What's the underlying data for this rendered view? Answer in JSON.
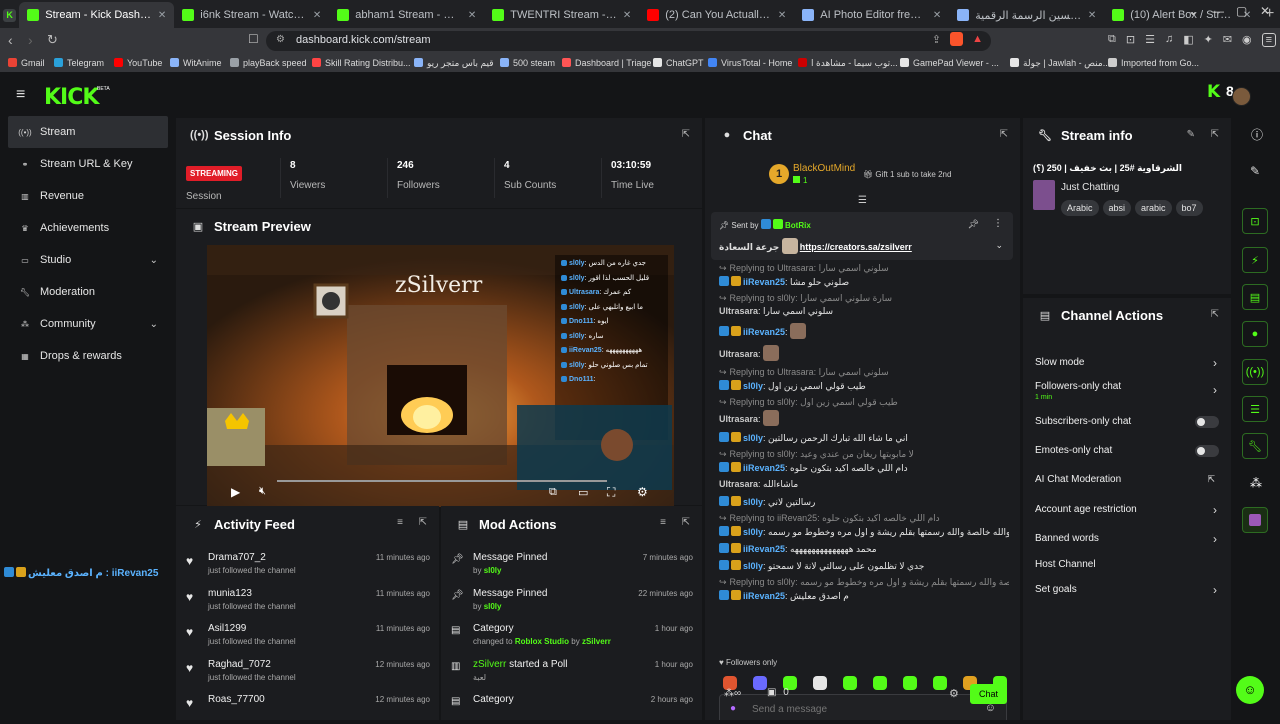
{
  "browser": {
    "tabs": [
      {
        "title": "Stream - Kick Dashboard",
        "color": "#53fc18",
        "active": true
      },
      {
        "title": "i6nk Stream - Watch Live on",
        "color": "#53fc18"
      },
      {
        "title": "abham1 Stream - Watch Live",
        "color": "#53fc18"
      },
      {
        "title": "TWENTRI Stream - Watch Liv",
        "color": "#53fc18"
      },
      {
        "title": "(2) Can You Actually Beat Min",
        "color": "#ff0000"
      },
      {
        "title": "AI Photo Editor free : Pixlr Exp",
        "color": "#8ab4f8"
      },
      {
        "title": "نصائح لتحسين الرسمة الرقمية",
        "color": "#8ab4f8"
      },
      {
        "title": "(10) Alert Box / Streamlabs",
        "color": "#53fc18"
      }
    ],
    "url": "dashboard.kick.com/stream",
    "bookmarks": [
      {
        "label": "Gmail",
        "color": "#ea4335"
      },
      {
        "label": "Telegram",
        "color": "#2aa1da"
      },
      {
        "label": "YouTube",
        "color": "#ff0000"
      },
      {
        "label": "WitAnime",
        "color": "#8ab4f8"
      },
      {
        "label": "playBack speed",
        "color": "#9aa0a6"
      },
      {
        "label": "Skill Rating Distribu...",
        "color": "#ff4444"
      },
      {
        "label": "قيم باس متجر ريو",
        "color": "#8ab4f8"
      },
      {
        "label": "500 steam",
        "color": "#8ab4f8"
      },
      {
        "label": "Dashboard | Triage",
        "color": "#ff5555"
      },
      {
        "label": "ChatGPT",
        "color": "#e6e6e6"
      },
      {
        "label": "VirusTotal - Home",
        "color": "#4285f4"
      },
      {
        "label": "توب سيما - مشاهدة ا...",
        "color": "#c00"
      },
      {
        "label": "GamePad Viewer - ...",
        "color": "#e6e6e6"
      },
      {
        "label": "جولة | Jawlah - منص...",
        "color": "#e6e6e6"
      },
      {
        "label": "Imported from Go...",
        "color": "#ccc"
      }
    ]
  },
  "topnav": {
    "logo": "KICK",
    "beta": "BETA",
    "viewer_count": "8"
  },
  "sidebar": {
    "items": [
      {
        "label": "Stream",
        "icon": "broadcast-icon",
        "active": true
      },
      {
        "label": "Stream URL & Key",
        "icon": "link-icon"
      },
      {
        "label": "Revenue",
        "icon": "revenue-icon"
      },
      {
        "label": "Achievements",
        "icon": "trophy-icon"
      },
      {
        "label": "Studio",
        "icon": "studio-icon",
        "chevron": true
      },
      {
        "label": "Moderation",
        "icon": "wrench-icon"
      },
      {
        "label": "Community",
        "icon": "community-icon",
        "chevron": true
      },
      {
        "label": "Drops & rewards",
        "icon": "drops-icon"
      }
    ],
    "overlay_chat": "م اصدق معليش : iiRevan25"
  },
  "session": {
    "title": "Session Info",
    "status": "STREAMING",
    "status_label": "Session",
    "viewers": "8",
    "viewers_label": "Viewers",
    "followers": "246",
    "followers_label": "Followers",
    "subs": "4",
    "subs_label": "Sub Counts",
    "time": "03:10:59",
    "time_label": "Time Live"
  },
  "preview": {
    "title": "Stream Preview",
    "overlay_name": "zSilverr",
    "overlay_chat": [
      {
        "user": "sl0ly",
        "text": "جدي غاره من الدس"
      },
      {
        "user": "sl0ly",
        "text": "قليل الحسب لذا اقور"
      },
      {
        "user": "Ultrasara",
        "text": "كم عمرك"
      },
      {
        "user": "sl0ly",
        "text": "ما ابيع واتلبهي على"
      },
      {
        "user": "Dno111",
        "text": "ايوه"
      },
      {
        "user": "sl0ly",
        "text": "ساره"
      },
      {
        "user": "iiRevan25",
        "text": "ههههههههههه"
      },
      {
        "user": "sl0ly",
        "text": "تمام بس صلوني حلو"
      },
      {
        "user": "Dno111",
        "text": ""
      }
    ]
  },
  "activity": {
    "title": "Activity Feed",
    "items": [
      {
        "name": "Drama707_2",
        "sub": "just followed the channel",
        "time": "11 minutes ago"
      },
      {
        "name": "munia123",
        "sub": "just followed the channel",
        "time": "11 minutes ago"
      },
      {
        "name": "Asil1299",
        "sub": "just followed the channel",
        "time": "11 minutes ago"
      },
      {
        "name": "Raghad_7072",
        "sub": "just followed the channel",
        "time": "12 minutes ago"
      },
      {
        "name": "Roas_77700",
        "sub": "",
        "time": "12 minutes ago"
      }
    ]
  },
  "mod": {
    "title": "Mod Actions",
    "items": [
      {
        "icon": "pin-icon",
        "name": "Message Pinned",
        "by": "by",
        "user": "sl0ly",
        "time": "7 minutes ago"
      },
      {
        "icon": "pin-icon",
        "name": "Message Pinned",
        "by": "by",
        "user": "sl0ly",
        "time": "22 minutes ago"
      },
      {
        "icon": "category-icon",
        "name": "Category",
        "by": "changed to",
        "cat": "Roblox Studio",
        "by2": "by",
        "user": "zSilverr",
        "time": "1 hour ago"
      },
      {
        "icon": "poll-icon",
        "name": "zSilverr",
        "name2": "started a Poll",
        "by": "لعبة",
        "time": "1 hour ago"
      },
      {
        "icon": "category-icon",
        "name": "Category",
        "time": "2 hours ago"
      }
    ]
  },
  "chat": {
    "title": "Chat",
    "top_gifter": "BlackOutMind",
    "top_rank": "1",
    "top_count": "1",
    "gift_text": "Gift 1 sub to take 2nd",
    "pinned_sent_by": "Sent by",
    "pinned_user": "BotRix",
    "pinned_prefix": "جرعة السعادة",
    "pinned_link": "https://creators.sa/zsilverr",
    "lines": [
      {
        "type": "rep",
        "text": "Replying to Ultrasara: سلوني اسمي سارا"
      },
      {
        "type": "msg",
        "user": "iiRevan25",
        "color": "usr",
        "text": "صلوني حلو مشا"
      },
      {
        "type": "rep",
        "text": "Replying to sl0ly: سارة سلوني اسمي سارا"
      },
      {
        "type": "msg",
        "user": "Ultrasara",
        "color": "gray",
        "text": "سلوني اسمي سارا"
      },
      {
        "type": "msg",
        "user": "iiRevan25",
        "color": "usr",
        "text": ""
      },
      {
        "type": "msg",
        "user": "Ultrasara",
        "color": "gray",
        "text": ""
      },
      {
        "type": "rep",
        "text": "Replying to Ultrasara: سلوني اسمي سارا"
      },
      {
        "type": "msg",
        "user": "sl0ly",
        "color": "usr",
        "text": "طيب قولي اسمي زين اول"
      },
      {
        "type": "rep",
        "text": "Replying to sl0ly: طيب قولي اسمي زين اول"
      },
      {
        "type": "msg",
        "user": "Ultrasara",
        "color": "gray",
        "text": ""
      },
      {
        "type": "msg",
        "user": "sl0ly",
        "color": "usr",
        "text": "اني ما شاء الله تبارك الرحمن رسالتين"
      },
      {
        "type": "rep",
        "text": "Replying to sl0ly: لا مابوبتها ريغان من عندي وعيد"
      },
      {
        "type": "msg",
        "user": "iiRevan25",
        "color": "usr",
        "text": "دام اللي خالصه اكيد بتكون حلوه"
      },
      {
        "type": "msg",
        "user": "Ultrasara",
        "color": "gray",
        "text": "ماشاءالله"
      },
      {
        "type": "msg",
        "user": "sl0ly",
        "color": "usr",
        "text": "رسالتين لاني"
      },
      {
        "type": "rep",
        "text": "Replying to iiRevan25: دام اللي خالصه اكيد بتكون حلوه"
      },
      {
        "type": "msg",
        "user": "sl0ly",
        "color": "usr",
        "text": "والله خالصة والله رسمتها بقلم ريشة و اول مره وخطوط مو رسمه"
      },
      {
        "type": "msg",
        "user": "iiRevan25",
        "color": "usr",
        "text": "محمد ههههههههههههههه"
      },
      {
        "type": "msg",
        "user": "sl0ly",
        "color": "usr",
        "text": "جدي لا تظلمون على رسالتي لانة لا سمحتو"
      },
      {
        "type": "rep",
        "text": "Replying to sl0ly: والله خالصة والله رسمتها بقلم ريشة و اول مره وخطوط مو رسمه"
      },
      {
        "type": "msg",
        "user": "iiRevan25",
        "color": "usr",
        "text": "م اصدق معليش"
      }
    ],
    "followers_only": "Followers only",
    "placeholder": "Send a message",
    "points": "0",
    "send": "Chat"
  },
  "streaminfo": {
    "title": "Stream info",
    "stream_title": "الشرقاوية #25 | بث خفيف | 250 (؟)",
    "category": "Just Chatting",
    "tags": [
      "Arabic",
      "absi",
      "arabic",
      "bo7"
    ]
  },
  "actions": {
    "title": "Channel Actions",
    "items": [
      {
        "label": "Slow mode",
        "kind": "chev"
      },
      {
        "label": "Followers-only chat",
        "sub": "1 min",
        "kind": "chev"
      },
      {
        "label": "Subscribers-only chat",
        "kind": "toggle"
      },
      {
        "label": "Emotes-only chat",
        "kind": "toggle"
      },
      {
        "label": "AI Chat Moderation",
        "kind": "ext"
      },
      {
        "label": "Account age restriction",
        "kind": "chev"
      },
      {
        "label": "Banned words",
        "kind": "chev"
      },
      {
        "label": "Host Channel",
        "kind": "none"
      },
      {
        "label": "Set goals",
        "kind": "chev"
      }
    ]
  },
  "colors": {
    "accent": "#53fc18",
    "live": "#e11d28",
    "link": "#5bb3ff"
  }
}
